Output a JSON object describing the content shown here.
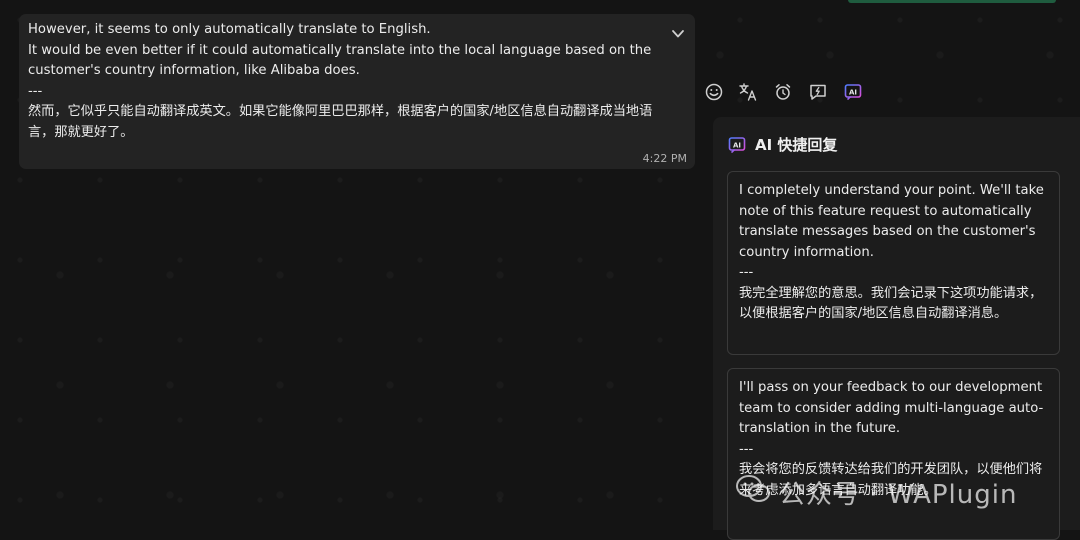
{
  "message": {
    "text": "However, it seems to only automatically translate to English.\nIt would be even better if it could automatically translate into the local language based on the customer's country information, like Alibaba does.\n---\n然而，它似乎只能自动翻译成英文。如果它能像阿里巴巴那样，根据客户的国家/地区信息自动翻译成当地语言，那就更好了。",
    "time": "4:22 PM"
  },
  "toolbar": {
    "icons": [
      "emoji-icon",
      "translate-icon",
      "alarm-icon",
      "reply-icon",
      "ai-icon"
    ]
  },
  "ai_panel": {
    "title": "AI 快捷回复",
    "replies": [
      "I completely understand your point. We'll take note of this feature request to automatically translate messages based on the customer's country information.\n---\n我完全理解您的意思。我们会记录下这项功能请求，以便根据客户的国家/地区信息自动翻译消息。",
      "I'll pass on your feedback to our development team to consider adding multi-language auto-translation in the future.\n---\n我会将您的反馈转达给我们的开发团队，以便他们将来考虑添加多语言自动翻译功能。"
    ]
  },
  "watermark": {
    "text": "公众号 · WAPlugin"
  },
  "colors": {
    "background": "#141414",
    "bubble": "#232323",
    "panel": "#1c1c1c",
    "accent_green": "#1f5c3f",
    "ai_icon_gradient": [
      "#4f7cff",
      "#d94fd9"
    ]
  }
}
